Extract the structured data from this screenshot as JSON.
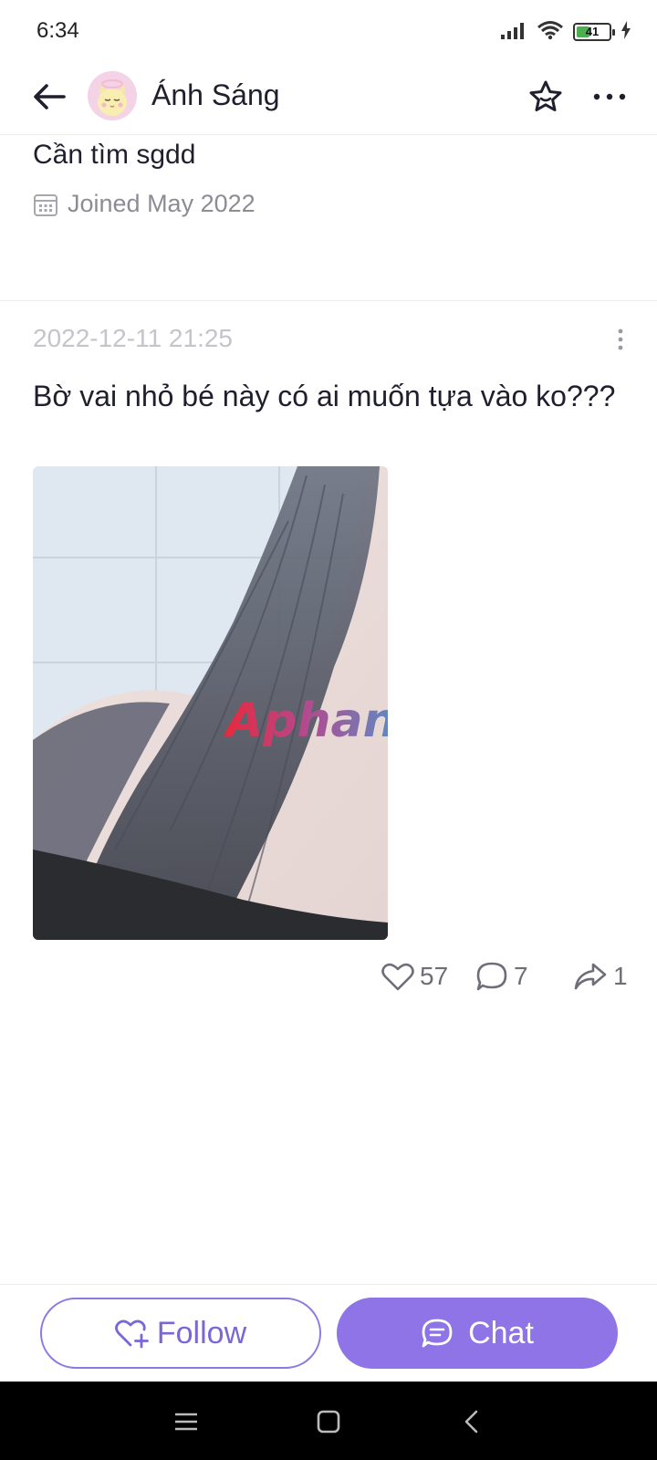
{
  "status_bar": {
    "time": "6:34",
    "battery_level": "41",
    "battery_fraction": 0.41
  },
  "header": {
    "title": "Ánh Sáng",
    "back_icon": "arrow-left-icon",
    "star_icon": "star-icon",
    "more_icon": "more-horizontal-icon"
  },
  "profile": {
    "bio": "Cần tìm sgdd",
    "joined": "Joined May 2022",
    "joined_icon": "calendar-icon"
  },
  "post": {
    "timestamp": "2022-12-11 21:25",
    "text": "Bờ vai nhỏ bé này có ai muốn tựa vào ko???",
    "watermark": "Aphang",
    "likes": "57",
    "comments": "7",
    "shares": "1"
  },
  "bottom_bar": {
    "follow_label": "Follow",
    "chat_label": "Chat"
  },
  "colors": {
    "accent": "#8e74e6",
    "accent_text": "#7b67d8",
    "muted": "#8c8c96"
  }
}
